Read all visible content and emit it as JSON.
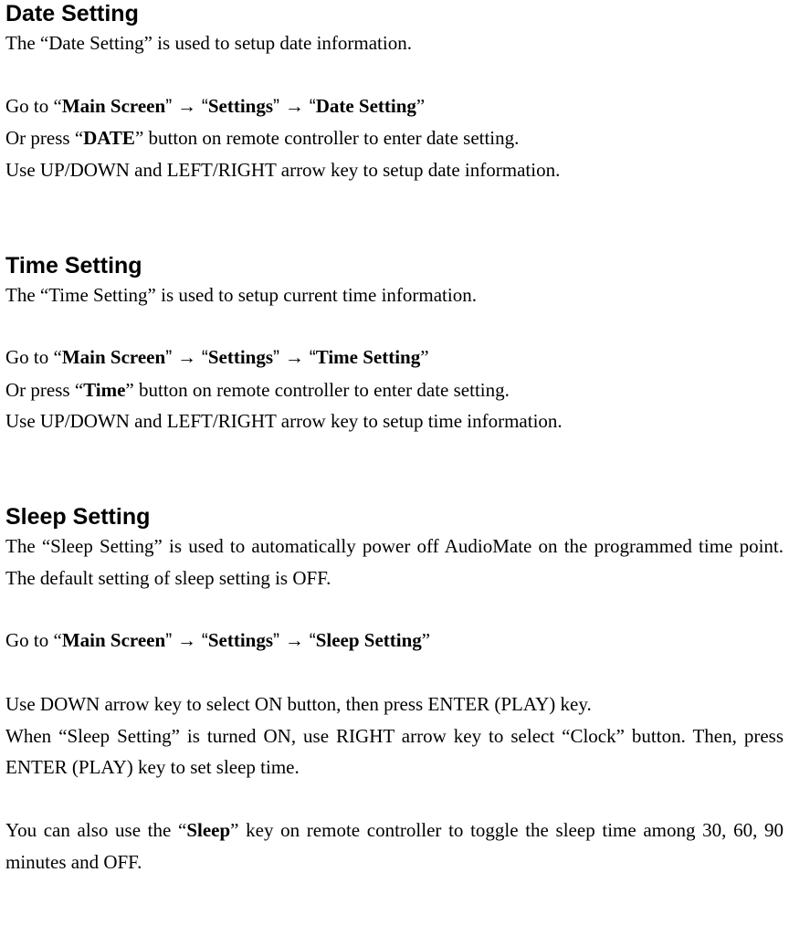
{
  "sections": {
    "date": {
      "title": "Date Setting",
      "desc": "The “Date Setting” is used to setup date information.",
      "nav": {
        "prefix": "Go to “",
        "b1": "Main Screen",
        "mid1": "” → “",
        "b2": "Settings",
        "mid2": "” → “",
        "b3": "Date Setting",
        "suffix": "”"
      },
      "press": {
        "pre": "Or press “",
        "btn": "DATE",
        "post": "” button on remote controller to enter date setting."
      },
      "usage": "Use UP/DOWN and LEFT/RIGHT arrow key to setup date information."
    },
    "time": {
      "title": "Time Setting",
      "desc": "The “Time Setting” is used to setup current time information.",
      "nav": {
        "prefix": "Go to “",
        "b1": "Main Screen",
        "mid1": "” → “",
        "b2": "Settings",
        "mid2": "” → “",
        "b3": "Time Setting",
        "suffix": "”"
      },
      "press": {
        "pre": "Or press “",
        "btn": "Time",
        "post": "” button on remote controller to enter date setting."
      },
      "usage": "Use UP/DOWN and LEFT/RIGHT arrow key to setup time information."
    },
    "sleep": {
      "title": "Sleep Setting",
      "desc": "The “Sleep Setting” is used to automatically power off AudioMate on the programmed time point. The default setting of sleep setting is OFF.",
      "nav": {
        "prefix": "Go to “",
        "b1": "Main Screen",
        "mid1": "” → “",
        "b2": "Settings",
        "mid2": "” → “",
        "b3": "Sleep Setting",
        "suffix": "”"
      },
      "usage1": "Use DOWN arrow key to select ON button, then press ENTER (PLAY) key.",
      "usage2": "When “Sleep Setting” is turned ON, use RIGHT arrow key to select “Clock” button. Then, press ENTER (PLAY) key to set sleep time.",
      "toggle": {
        "pre": "You can also use the “",
        "btn": "Sleep",
        "post": "” key on remote controller to toggle the sleep time among 30, 60, 90 minutes and OFF."
      }
    }
  }
}
